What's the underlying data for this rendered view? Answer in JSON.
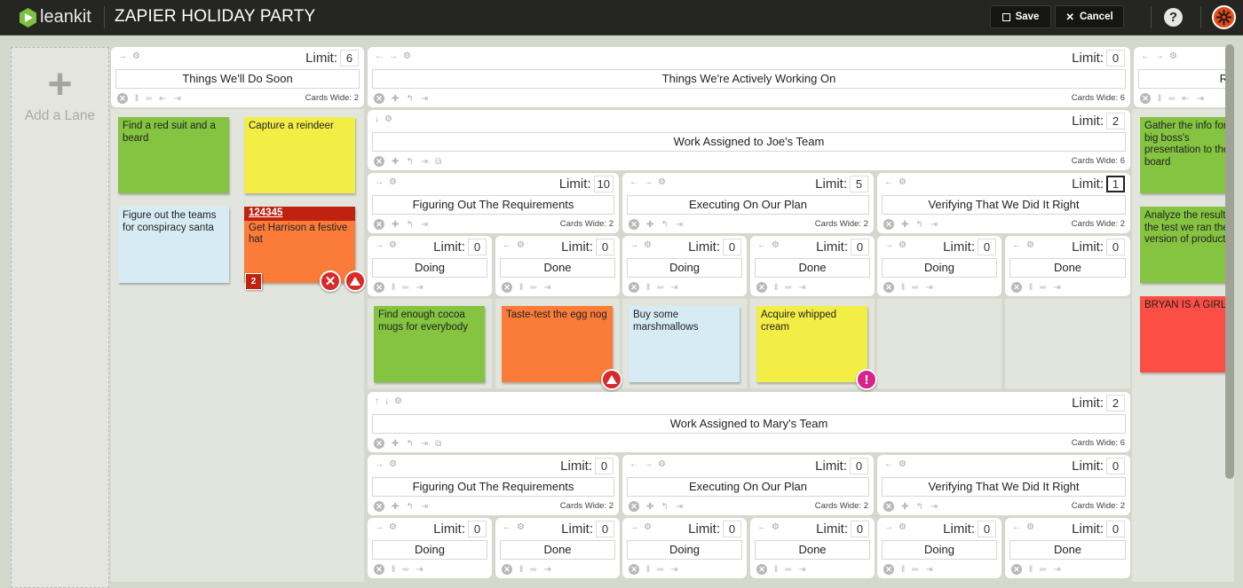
{
  "app": {
    "logo_text": "leankit",
    "board_title": "ZAPIER HOLIDAY PARTY",
    "save_label": "Save",
    "cancel_label": "Cancel",
    "help_label": "?",
    "colors": {
      "topbar": "#252622",
      "brand_green": "#7cc142",
      "avatar": "#e04b1a"
    }
  },
  "add_lane": {
    "plus": "+",
    "label": "Add a Lane"
  },
  "limit_label": "Limit:",
  "cards_wide_prefix": "Cards Wide:",
  "lanes": {
    "soon": {
      "name": "Things We'll Do Soon",
      "limit": "6",
      "cards_wide": "2"
    },
    "active": {
      "name": "Things We're Actively Working On",
      "limit": "0",
      "cards_wide": "6"
    },
    "right_partial": {
      "name": "R"
    },
    "joe": {
      "name": "Work Assigned to Joe's Team",
      "limit": "2",
      "cards_wide": "6"
    },
    "joe_req": {
      "name": "Figuring Out The Requirements",
      "limit": "10",
      "cards_wide": "2"
    },
    "joe_exec": {
      "name": "Executing On Our Plan",
      "limit": "5",
      "cards_wide": "2"
    },
    "joe_verify": {
      "name": "Verifying That We Did It Right",
      "limit": "1",
      "cards_wide": "2"
    },
    "joe_sub": [
      {
        "name": "Doing",
        "limit": "0"
      },
      {
        "name": "Done",
        "limit": "0"
      },
      {
        "name": "Doing",
        "limit": "0"
      },
      {
        "name": "Done",
        "limit": "0"
      },
      {
        "name": "Doing",
        "limit": "0"
      },
      {
        "name": "Done",
        "limit": "0"
      }
    ],
    "mary": {
      "name": "Work Assigned to Mary's Team",
      "limit": "2",
      "cards_wide": "6"
    },
    "mary_req": {
      "name": "Figuring Out The Requirements",
      "limit": "0",
      "cards_wide": "2"
    },
    "mary_exec": {
      "name": "Executing On Our Plan",
      "limit": "0",
      "cards_wide": "2"
    },
    "mary_verify": {
      "name": "Verifying That We Did It Right",
      "limit": "0",
      "cards_wide": "2"
    },
    "mary_sub": [
      {
        "name": "Doing",
        "limit": "0"
      },
      {
        "name": "Done",
        "limit": "0"
      },
      {
        "name": "Doing",
        "limit": "0"
      },
      {
        "name": "Done",
        "limit": "0"
      },
      {
        "name": "Doing",
        "limit": "0"
      },
      {
        "name": "Done",
        "limit": "0"
      }
    ]
  },
  "cards": {
    "soon": [
      {
        "text": "Find a red suit and a beard",
        "color": "green"
      },
      {
        "text": "Capture a reindeer",
        "color": "yellow"
      },
      {
        "text": "Figure out the teams for conspiracy santa",
        "color": "blue"
      },
      {
        "id": "124345",
        "text": "Get Harrison a festive hat",
        "color": "orange",
        "badge": "2"
      }
    ],
    "joe": [
      {
        "text": "Find enough cocoa mugs for everybody",
        "color": "green"
      },
      {
        "text": "Taste-test the egg nog",
        "color": "orange"
      },
      {
        "text": "Buy some marshmallows",
        "color": "blue"
      },
      {
        "text": "Acquire whipped cream",
        "color": "yellow"
      }
    ],
    "right": [
      {
        "text": "Gather the info for the big boss's presentation to the board",
        "color": "green"
      },
      {
        "text": "Analyze the results of the test we ran the version of product",
        "color": "green"
      },
      {
        "text": "BRYAN IS A GIRL",
        "color": "red"
      }
    ]
  }
}
